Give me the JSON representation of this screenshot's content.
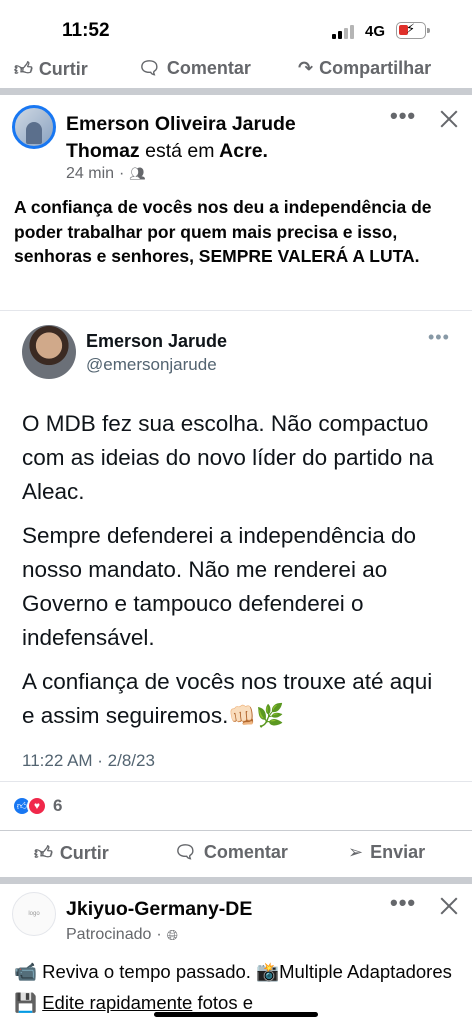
{
  "status_bar": {
    "time": "11:52",
    "network": "4G"
  },
  "top_actions": {
    "like": "Curtir",
    "comment": "Comentar",
    "share": "Compartilhar"
  },
  "post": {
    "author": "Emerson Oliveira Jarude Thomaz",
    "checkin_prefix": "está em",
    "checkin_place": "Acre.",
    "time": "24 min",
    "audience_icon": "friends-icon",
    "text": "A confiança de vocês nos deu a independência de poder trabalhar por quem mais precisa e isso, senhoras e senhores, SEMPRE VALERÁ A LUTA.",
    "tweet": {
      "name": "Emerson Jarude",
      "handle": "@emersonjarude",
      "paragraphs": [
        "O MDB fez sua escolha. Não compactuo com as ideias do novo líder do partido na Aleac.",
        "Sempre defenderei a independência do nosso mandato. Não me renderei ao Governo e tampouco defenderei o indefensável.",
        "A confiança de vocês nos trouxe até aqui e assim seguiremos.👊🏻🌿"
      ],
      "timestamp": "11:22 AM · 2/8/23"
    },
    "reactions": {
      "count": "6",
      "types": [
        "like",
        "love"
      ]
    },
    "actions": {
      "like": "Curtir",
      "comment": "Comentar",
      "send": "Enviar"
    }
  },
  "ad_post": {
    "author": "Jkiyuo-Germany-DE",
    "label": "Patrocinado",
    "text_part1": "📹 Reviva o tempo passado. 📸Multiple Adaptadores 💾 ",
    "text_underlined": "Edite rapidamente",
    "text_part2": " fotos e"
  },
  "colors": {
    "accent": "#1877f2",
    "muted": "#65676b",
    "love": "#f0284a"
  }
}
